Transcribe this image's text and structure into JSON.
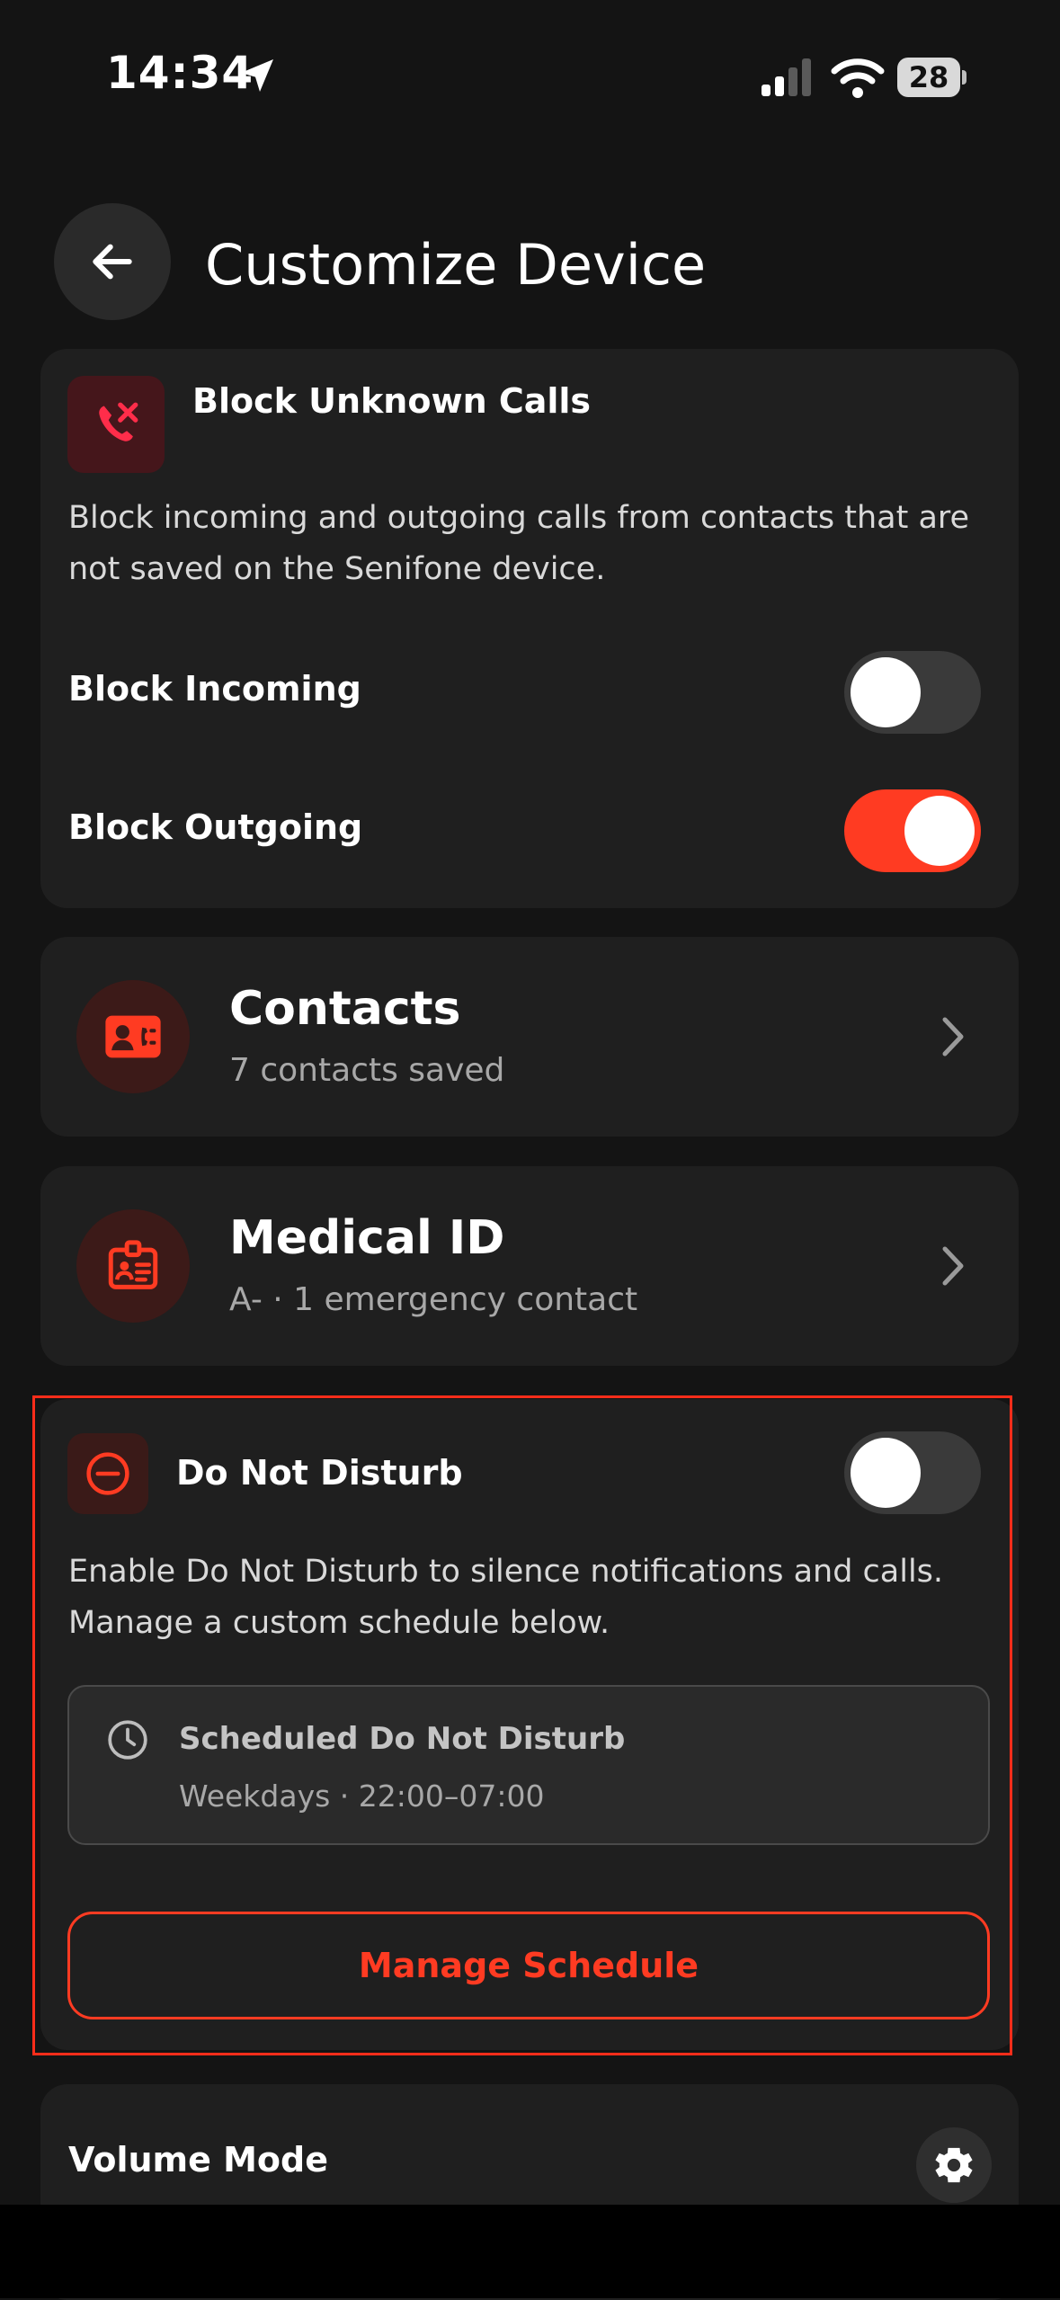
{
  "status_bar": {
    "time": "14:34",
    "battery": "28"
  },
  "header": {
    "title": "Customize Device"
  },
  "block_unknown_calls": {
    "title": "Block Unknown Calls",
    "description": "Block incoming and outgoing calls from contacts that are not saved on the Senifone device.",
    "block_incoming": {
      "label": "Block Incoming",
      "enabled": false
    },
    "block_outgoing": {
      "label": "Block Outgoing",
      "enabled": true
    }
  },
  "contacts": {
    "title": "Contacts",
    "subtitle": "7 contacts saved"
  },
  "medical_id": {
    "title": "Medical ID",
    "subtitle": "A- · 1 emergency contact"
  },
  "do_not_disturb": {
    "title": "Do Not Disturb",
    "enabled": false,
    "description": "Enable Do Not Disturb to silence notifications and calls. Manage a custom schedule below.",
    "schedule": {
      "title": "Scheduled Do Not Disturb",
      "detail": "Weekdays · 22:00–07:00"
    },
    "manage_button": "Manage Schedule"
  },
  "volume_mode": {
    "title": "Volume Mode"
  },
  "colors": {
    "accent": "#ff3b22",
    "background": "#141414",
    "card": "#1f1f1f"
  }
}
